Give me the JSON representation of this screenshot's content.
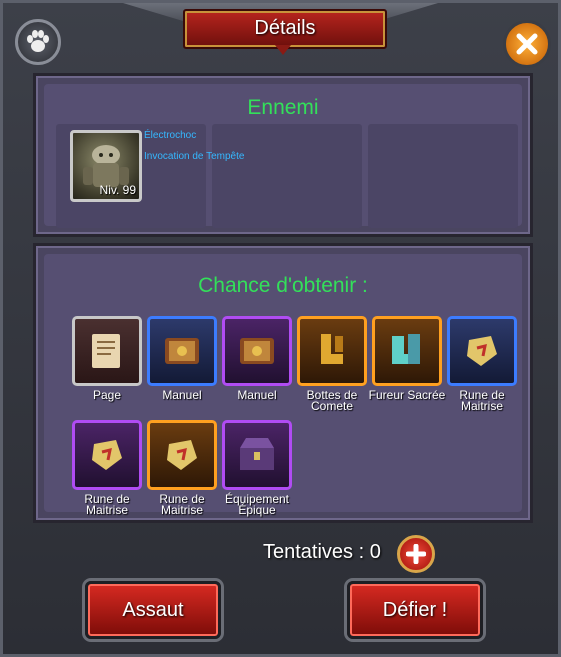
{
  "header": {
    "title": "Détails"
  },
  "enemy": {
    "heading": "Ennemi",
    "level_label": "Niv. 99",
    "skills": [
      "Électrochoc",
      "Invocation de Tempête"
    ]
  },
  "loot": {
    "heading": "Chance d'obtenir :",
    "items": [
      {
        "label": "Page",
        "rarity": "gray",
        "icon": "scroll-icon"
      },
      {
        "label": "Manuel",
        "rarity": "blue",
        "icon": "book-icon"
      },
      {
        "label": "Manuel",
        "rarity": "purple",
        "icon": "book-icon"
      },
      {
        "label": "Bottes de Comete",
        "rarity": "orange",
        "icon": "boots-icon"
      },
      {
        "label": "Fureur Sacrée",
        "rarity": "orange",
        "icon": "armor-boots-icon"
      },
      {
        "label": "Rune de Maitrise",
        "rarity": "blue",
        "icon": "rune-icon"
      },
      {
        "label": "Rune de Maitrise",
        "rarity": "purple",
        "icon": "rune-icon"
      },
      {
        "label": "Rune de Maitrise",
        "rarity": "orange",
        "icon": "rune-icon"
      },
      {
        "label": "Équipement Épique",
        "rarity": "purple",
        "icon": "chest-icon"
      }
    ]
  },
  "footer": {
    "tentatives_label": "Tentatives : 0",
    "assault_label": "Assaut",
    "defier_label": "Défier !"
  }
}
